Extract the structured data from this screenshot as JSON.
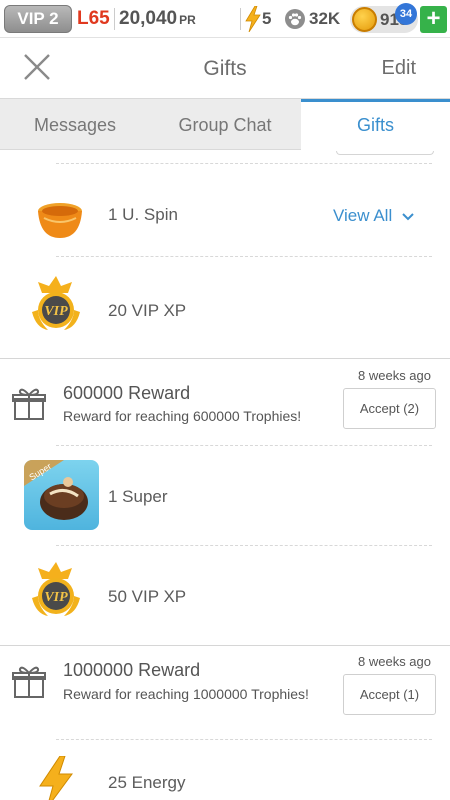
{
  "status_bar": {
    "vip_label": "VIP 2",
    "level": "L65",
    "pr_value": "20,040",
    "pr_unit": "PR",
    "energy": "5",
    "paws": "32K",
    "coins": "913",
    "plus": "+"
  },
  "header": {
    "title": "Gifts",
    "edit_label": "Edit"
  },
  "tabs": [
    {
      "label": "Messages",
      "active": false
    },
    {
      "label": "Group Chat",
      "active": false
    },
    {
      "label": "Gifts",
      "active": true,
      "badge": "34"
    }
  ],
  "gift_group_1": {
    "items": [
      {
        "label": "1 U. Spin",
        "icon": "spin-bowl-icon"
      },
      {
        "label": "20 VIP XP",
        "icon": "vip-medal-icon"
      }
    ],
    "view_all_label": "View All"
  },
  "rewards": [
    {
      "icon": "gift-icon",
      "title": "600000 Reward",
      "subtitle": "Reward for reaching 600000 Trophies!",
      "time": "8 weeks ago",
      "accept_label": "Accept (2)",
      "items": [
        {
          "label": "1 Super",
          "icon": "super-card-icon",
          "card_tag": "Super"
        },
        {
          "label": "50 VIP XP",
          "icon": "vip-medal-icon"
        }
      ]
    },
    {
      "icon": "gift-icon",
      "title": "1000000 Reward",
      "subtitle": "Reward for reaching 1000000 Trophies!",
      "time": "8 weeks ago",
      "accept_label": "Accept (1)",
      "items": [
        {
          "label": "25 Energy",
          "icon": "energy-bolt-icon"
        }
      ]
    }
  ],
  "vip_medal_text": "VIP",
  "colors": {
    "accent": "#3a8fce",
    "level_red": "#e0391f",
    "plus_green": "#36b24a",
    "badge_blue": "#3376d8",
    "gold": "#f2b21c"
  }
}
